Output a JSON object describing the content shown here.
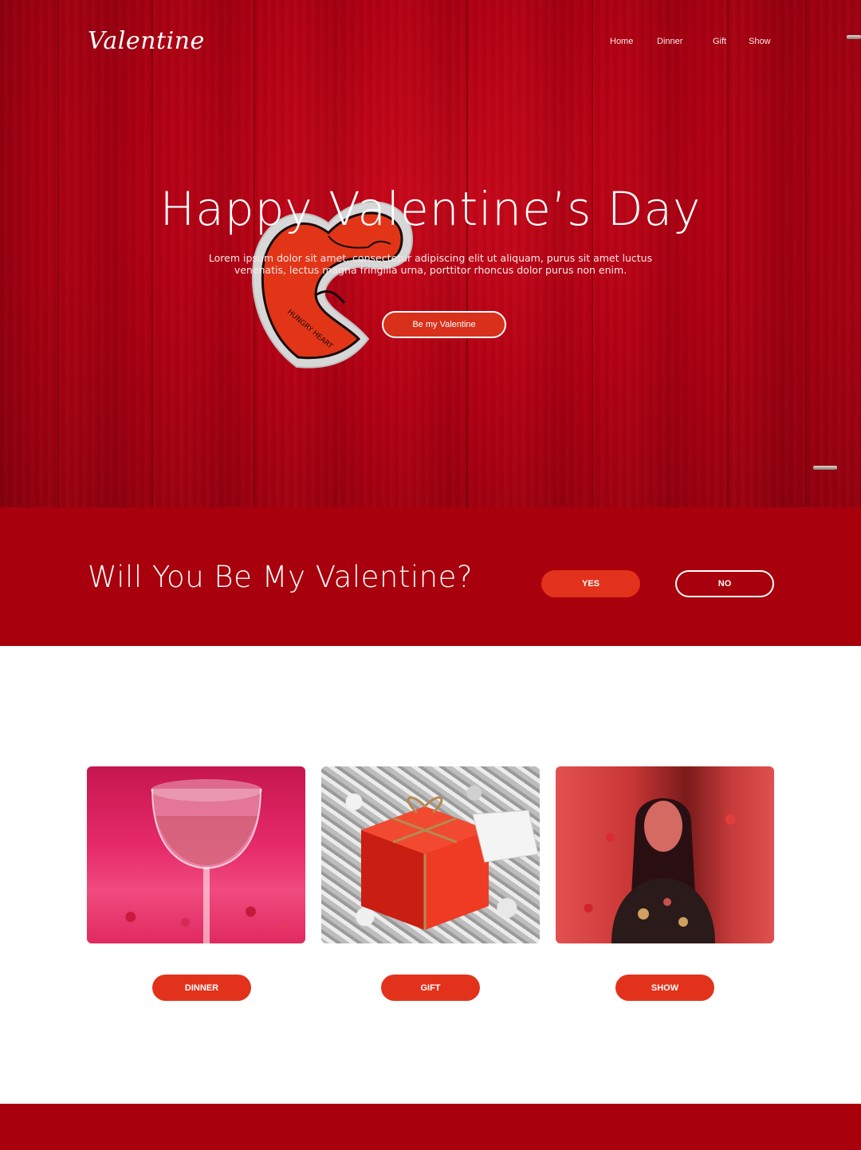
{
  "brand": {
    "logo": "Valentine"
  },
  "nav": {
    "home": "Home",
    "dinner": "Dinner",
    "gift": "Gift",
    "show": "Show"
  },
  "hero": {
    "title": "Happy Valentine’s Day",
    "subtitle_line1": "Lorem ipsum dolor sit amet, consectetur adipiscing elit ut aliquam, purus sit amet luctus",
    "subtitle_line2": "venenatis, lectus magna fringilla urna, porttitor rhoncus dolor purus non enim.",
    "cta_label": "Be my Valentine",
    "sticker_text": "HUNGRY HEART"
  },
  "question": {
    "text": "Will You Be My Valentine?",
    "yes_label": "YES",
    "no_label": "NO"
  },
  "cards": [
    {
      "label": "DINNER",
      "image": "wine-glass-photo"
    },
    {
      "label": "GIFT",
      "image": "red-gift-box-photo"
    },
    {
      "label": "SHOW",
      "image": "woman-petals-photo"
    }
  ],
  "colors": {
    "hero_red": "#b10013",
    "band_red": "#a8000c",
    "accent": "#e2321c",
    "white": "#ffffff"
  }
}
